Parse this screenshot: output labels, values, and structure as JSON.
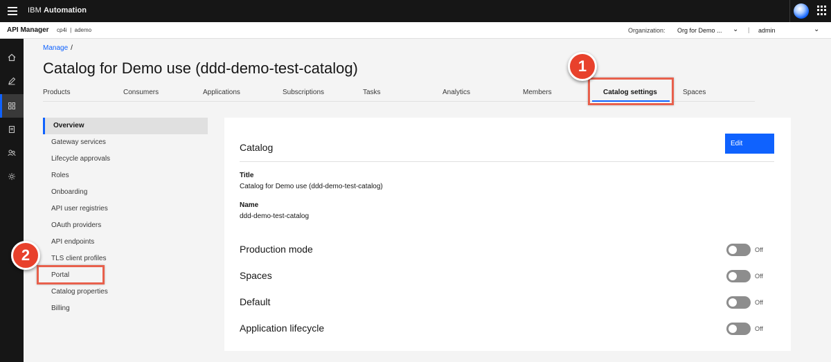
{
  "topbar": {
    "brand_prefix": "IBM",
    "brand_name": "Automation"
  },
  "subbar": {
    "app_name": "API Manager",
    "context": "cp4i  |  ademo",
    "org_label": "Organization:",
    "org_value": "Org for Demo ...",
    "separator": "|",
    "user": "admin"
  },
  "breadcrumb": {
    "link": "Manage",
    "separator": "/"
  },
  "page": {
    "title": "Catalog for Demo use (ddd-demo-test-catalog)"
  },
  "tabs": [
    {
      "label": "Products"
    },
    {
      "label": "Consumers"
    },
    {
      "label": "Applications"
    },
    {
      "label": "Subscriptions"
    },
    {
      "label": "Tasks"
    },
    {
      "label": "Analytics"
    },
    {
      "label": "Members"
    },
    {
      "label": "Catalog settings",
      "active": true
    },
    {
      "label": "Spaces"
    }
  ],
  "sidenav": [
    {
      "label": "Overview",
      "active": true
    },
    {
      "label": "Gateway services"
    },
    {
      "label": "Lifecycle approvals"
    },
    {
      "label": "Roles"
    },
    {
      "label": "Onboarding"
    },
    {
      "label": "API user registries"
    },
    {
      "label": "OAuth providers"
    },
    {
      "label": "API endpoints"
    },
    {
      "label": "TLS client profiles"
    },
    {
      "label": "Portal"
    },
    {
      "label": "Catalog properties"
    },
    {
      "label": "Billing"
    }
  ],
  "card": {
    "title": "Catalog",
    "edit_label": "Edit",
    "fields": [
      {
        "label": "Title",
        "value": "Catalog for Demo use (ddd-demo-test-catalog)"
      },
      {
        "label": "Name",
        "value": "ddd-demo-test-catalog"
      }
    ],
    "toggles": [
      {
        "label": "Production mode",
        "state": "Off"
      },
      {
        "label": "Spaces",
        "state": "Off"
      },
      {
        "label": "Default",
        "state": "Off"
      },
      {
        "label": "Application lifecycle",
        "state": "Off"
      }
    ]
  },
  "annotations": {
    "step1": "1",
    "step2": "2",
    "color": "#e8412c"
  },
  "colors": {
    "accent": "#0f62fe",
    "header": "#161616"
  }
}
